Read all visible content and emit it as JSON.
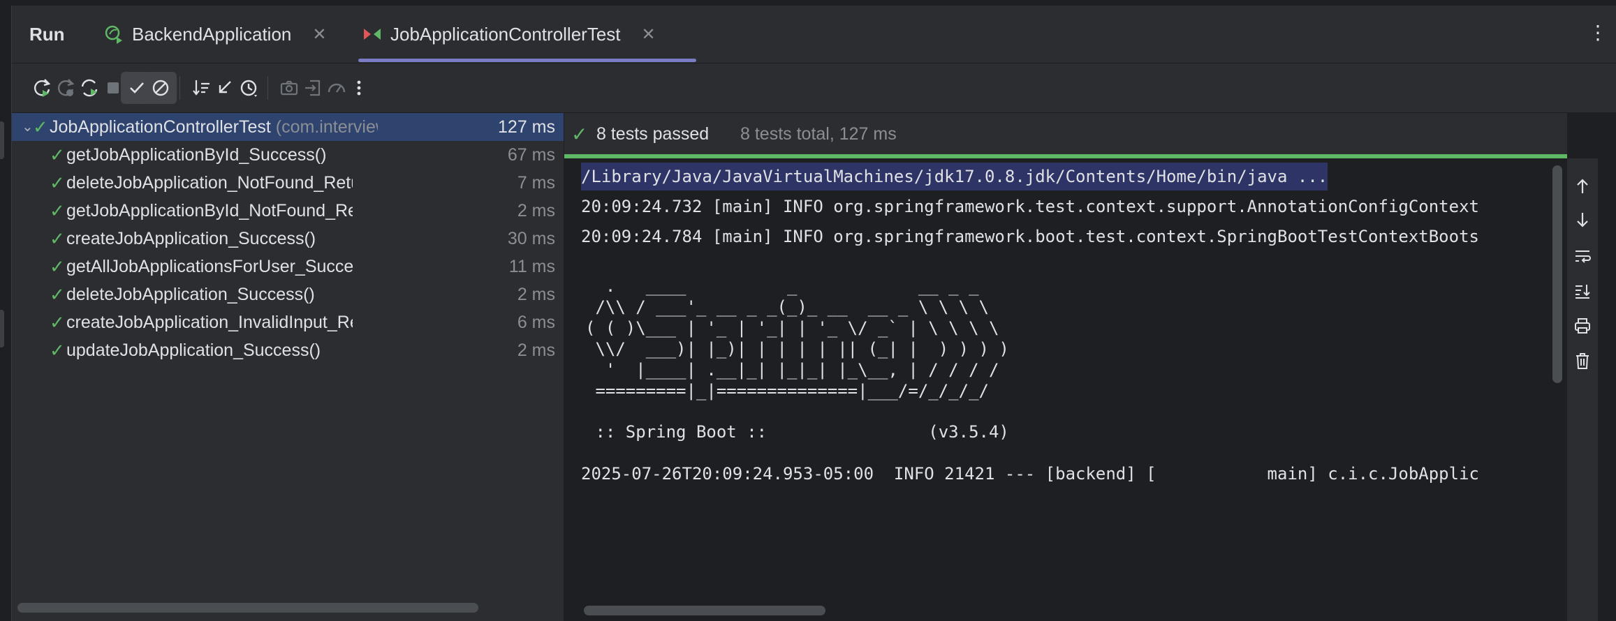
{
  "tool_window": {
    "title": "Run",
    "tabs": [
      {
        "label": "BackendApplication",
        "icon": "spring-run-icon"
      },
      {
        "label": "JobApplicationControllerTest",
        "icon": "test-run-icon"
      }
    ],
    "more_icon": "⋮"
  },
  "toolbar": {
    "buttons": [
      {
        "name": "rerun-icon"
      },
      {
        "name": "rerun-failed-icon"
      },
      {
        "name": "rerun-auto-icon"
      },
      {
        "name": "stop-icon"
      },
      {
        "name": "show-passed-icon",
        "active": true
      },
      {
        "name": "show-ignored-icon",
        "active": true
      },
      {
        "name": "sort-icon"
      },
      {
        "name": "collapse-icon"
      },
      {
        "name": "history-icon"
      },
      {
        "name": "screenshot-icon"
      },
      {
        "name": "export-icon"
      },
      {
        "name": "coverage-icon"
      },
      {
        "name": "more-icon"
      }
    ]
  },
  "test_tree": {
    "root": {
      "name": "JobApplicationControllerTest",
      "package": "(com.interviewcoacl",
      "time": "127 ms"
    },
    "tests": [
      {
        "name": "getJobApplicationById_Success()",
        "time": "67 ms"
      },
      {
        "name": "deleteJobApplication_NotFound_ReturnsNotFour",
        "time": "7 ms"
      },
      {
        "name": "getJobApplicationById_NotFound_ReturnsNotFou",
        "time": "2 ms"
      },
      {
        "name": "createJobApplication_Success()",
        "time": "30 ms"
      },
      {
        "name": "getAllJobApplicationsForUser_Success()",
        "time": "11 ms"
      },
      {
        "name": "deleteJobApplication_Success()",
        "time": "2 ms"
      },
      {
        "name": "createJobApplication_InvalidInput_ReturnsBadRe",
        "time": "6 ms"
      },
      {
        "name": "updateJobApplication_Success()",
        "time": "2 ms"
      }
    ]
  },
  "status": {
    "passed": "8 tests passed",
    "total": "8 tests total, 127 ms"
  },
  "console": {
    "lines": [
      "/Library/Java/JavaVirtualMachines/jdk17.0.8.jdk/Contents/Home/bin/java ...",
      "20:09:24.732 [main] INFO org.springframework.test.context.support.AnnotationConfigContext",
      "20:09:24.784 [main] INFO org.springframework.boot.test.context.SpringBootTestContextBoots",
      "",
      "  .   ____          _            __ _ _",
      " /\\\\ / ___'_ __ _ _(_)_ __  __ _ \\ \\ \\ \\",
      "( ( )\\___ | '_ | '_| | '_ \\/ _` | \\ \\ \\ \\",
      " \\\\/  ___)| |_)| | | | | || (_| |  ) ) ) )",
      "  '  |____| .__|_| |_|_| |_\\__, | / / / /",
      " =========|_|==============|___/=/_/_/_/",
      "",
      " :: Spring Boot ::                (v3.5.4)",
      "",
      "2025-07-26T20:09:24.953-05:00  INFO 21421 --- [backend] [           main] c.i.c.JobApplic"
    ]
  },
  "side_tools": [
    {
      "name": "scroll-up-icon"
    },
    {
      "name": "scroll-down-icon"
    },
    {
      "name": "soft-wrap-icon"
    },
    {
      "name": "scroll-to-end-icon"
    },
    {
      "name": "print-icon"
    },
    {
      "name": "clear-icon"
    }
  ],
  "colors": {
    "pass_green": "#5fb865",
    "selection": "#2e436e",
    "tab_underline": "#7a7cc4"
  }
}
